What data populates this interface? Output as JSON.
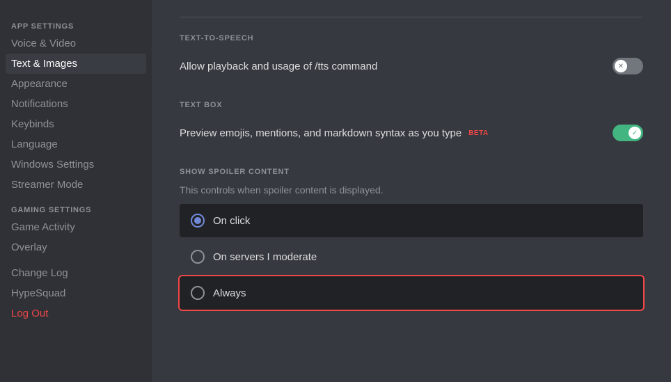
{
  "sidebar": {
    "app_settings_label": "APP SETTINGS",
    "gaming_settings_label": "GAMING SETTINGS",
    "items": [
      {
        "id": "voice-video",
        "label": "Voice & Video",
        "active": false
      },
      {
        "id": "text-images",
        "label": "Text & Images",
        "active": true
      },
      {
        "id": "appearance",
        "label": "Appearance",
        "active": false
      },
      {
        "id": "notifications",
        "label": "Notifications",
        "active": false
      },
      {
        "id": "keybinds",
        "label": "Keybinds",
        "active": false
      },
      {
        "id": "language",
        "label": "Language",
        "active": false
      },
      {
        "id": "windows-settings",
        "label": "Windows Settings",
        "active": false
      },
      {
        "id": "streamer-mode",
        "label": "Streamer Mode",
        "active": false
      }
    ],
    "gaming_items": [
      {
        "id": "game-activity",
        "label": "Game Activity",
        "active": false
      },
      {
        "id": "overlay",
        "label": "Overlay",
        "active": false
      }
    ],
    "bottom_items": [
      {
        "id": "change-log",
        "label": "Change Log",
        "active": false
      },
      {
        "id": "hypesquad",
        "label": "HypeSquad",
        "active": false
      }
    ],
    "logout_label": "Log Out"
  },
  "main": {
    "tts_section_label": "TEXT-TO-SPEECH",
    "tts_toggle_label": "Allow playback and usage of /tts command",
    "tts_toggle_state": "off",
    "textbox_section_label": "TEXT BOX",
    "textbox_toggle_label": "Preview emojis, mentions, and markdown syntax as you type",
    "textbox_beta_label": "BETA",
    "textbox_toggle_state": "on",
    "spoiler_section_label": "SHOW SPOILER CONTENT",
    "spoiler_description": "This controls when spoiler content is displayed.",
    "spoiler_options": [
      {
        "id": "on-click",
        "label": "On click",
        "selected": true,
        "focused": false
      },
      {
        "id": "on-servers",
        "label": "On servers I moderate",
        "selected": false,
        "focused": false
      },
      {
        "id": "always",
        "label": "Always",
        "selected": false,
        "focused": true
      }
    ]
  }
}
